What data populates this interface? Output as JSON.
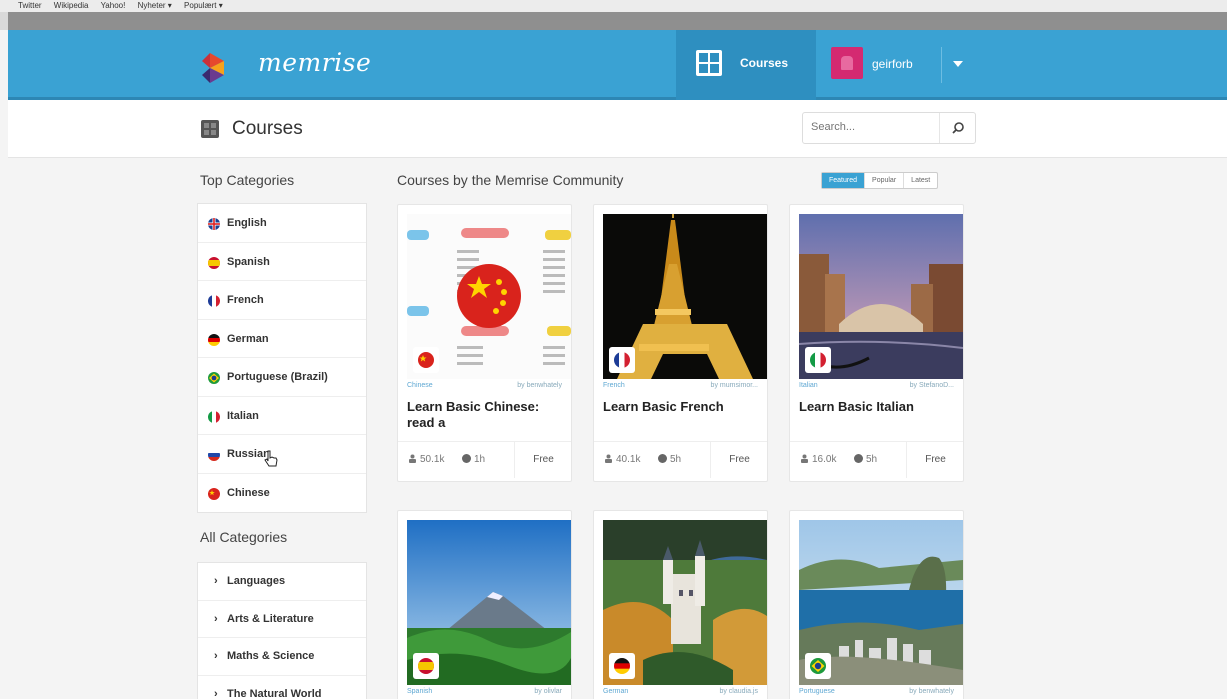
{
  "browser": {
    "bookmarks": [
      "Twitter",
      "Wikipedia",
      "Yahoo!",
      "Nyheter ▾",
      "Populært ▾"
    ]
  },
  "header": {
    "brand": "memrise",
    "nav_courses": "Courses",
    "username": "geirforb",
    "brand_color": "#3aa2d3"
  },
  "subheader": {
    "title": "Courses",
    "search_placeholder": "Search..."
  },
  "sidebar": {
    "top_heading": "Top Categories",
    "top_categories": [
      {
        "label": "English",
        "icon": "uk-flag-icon"
      },
      {
        "label": "Spanish",
        "icon": "spain-flag-icon"
      },
      {
        "label": "French",
        "icon": "france-flag-icon"
      },
      {
        "label": "German",
        "icon": "germany-flag-icon"
      },
      {
        "label": "Portuguese (Brazil)",
        "icon": "brazil-flag-icon"
      },
      {
        "label": "Italian",
        "icon": "italy-flag-icon"
      },
      {
        "label": "Russian",
        "icon": "russia-flag-icon"
      },
      {
        "label": "Chinese",
        "icon": "china-flag-icon"
      }
    ],
    "all_heading": "All Categories",
    "all_categories": [
      {
        "label": "Languages"
      },
      {
        "label": "Arts & Literature"
      },
      {
        "label": "Maths & Science"
      },
      {
        "label": "The Natural World"
      }
    ]
  },
  "main": {
    "heading": "Courses by the Memrise Community",
    "filters": [
      "Featured",
      "Popular",
      "Latest"
    ],
    "active_filter": "Featured",
    "courses": [
      {
        "lang": "Chinese",
        "by": "by benwhately",
        "title": "Learn Basic Chinese: read a",
        "learners": "50.1k",
        "time": "1h",
        "price": "Free"
      },
      {
        "lang": "French",
        "by": "by mumsimor...",
        "title": "Learn Basic French",
        "learners": "40.1k",
        "time": "5h",
        "price": "Free"
      },
      {
        "lang": "Italian",
        "by": "by StefanoD...",
        "title": "Learn Basic Italian",
        "learners": "16.0k",
        "time": "5h",
        "price": "Free"
      },
      {
        "lang": "Spanish",
        "by": "by olivlar",
        "title": "",
        "learners": "",
        "time": "",
        "price": ""
      },
      {
        "lang": "German",
        "by": "by claudia.js",
        "title": "",
        "learners": "",
        "time": "",
        "price": ""
      },
      {
        "lang": "Portuguese",
        "by": "by benwhately",
        "title": "",
        "learners": "",
        "time": "",
        "price": ""
      }
    ]
  }
}
